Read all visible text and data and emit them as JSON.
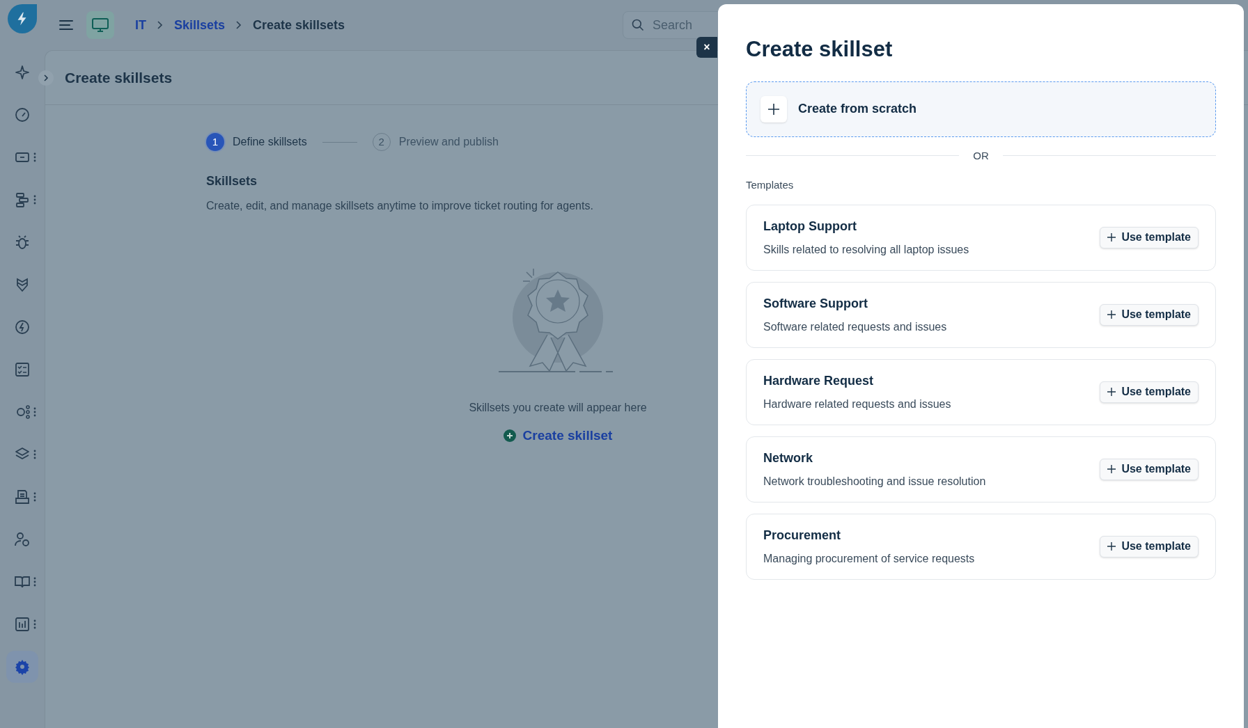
{
  "sidebar": {
    "items": [
      {
        "has_menu": false,
        "selected": false
      },
      {
        "has_menu": false,
        "selected": false
      },
      {
        "has_menu": true,
        "selected": false
      },
      {
        "has_menu": true,
        "selected": false
      },
      {
        "has_menu": false,
        "selected": false
      },
      {
        "has_menu": false,
        "selected": false
      },
      {
        "has_menu": false,
        "selected": false
      },
      {
        "has_menu": false,
        "selected": false
      },
      {
        "has_menu": true,
        "selected": false
      },
      {
        "has_menu": true,
        "selected": false
      },
      {
        "has_menu": true,
        "selected": false
      },
      {
        "has_menu": false,
        "selected": false
      },
      {
        "has_menu": true,
        "selected": false
      },
      {
        "has_menu": true,
        "selected": false
      },
      {
        "has_menu": false,
        "selected": true
      }
    ]
  },
  "breadcrumb": [
    "IT",
    "Skillsets",
    "Create skillsets"
  ],
  "search": {
    "placeholder": "Search"
  },
  "page": {
    "title": "Create skillsets",
    "steps": [
      {
        "number": "1",
        "label": "Define skillsets",
        "selected": true
      },
      {
        "number": "2",
        "label": "Preview and publish",
        "selected": false
      }
    ],
    "section_title": "Skillsets",
    "section_text": "Create, edit, and manage skillsets anytime to improve ticket routing for agents.",
    "empty_text": "Skillsets you create will appear here",
    "create_link": "Create skillset"
  },
  "close_label": "×",
  "drawer": {
    "title": "Create skillset",
    "scratch": "Create from scratch",
    "or": "OR",
    "templates_label": "Templates",
    "templates": [
      {
        "title": "Laptop Support",
        "description": "Skills related to resolving all laptop issues",
        "button": "Use template"
      },
      {
        "title": "Software Support",
        "description": "Software related requests and issues",
        "button": "Use template"
      },
      {
        "title": "Hardware Request",
        "description": "Hardware related requests and issues",
        "button": "Use template"
      },
      {
        "title": "Network",
        "description": "Network troubleshooting and issue resolution",
        "button": "Use template"
      },
      {
        "title": "Procurement",
        "description": "Managing procurement of service requests",
        "button": "Use template"
      }
    ]
  }
}
